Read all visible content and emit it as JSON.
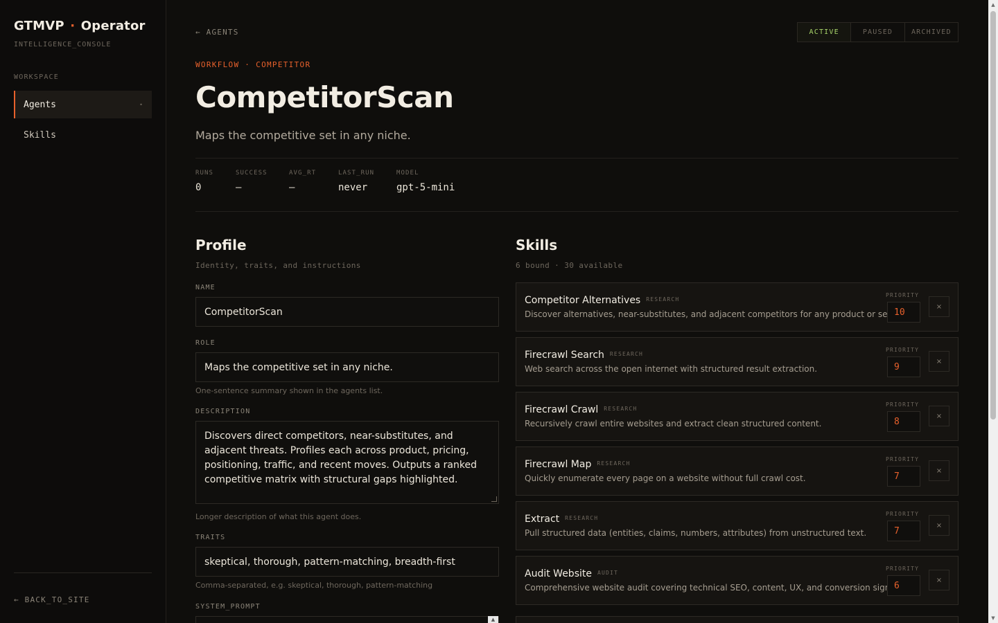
{
  "sidebar": {
    "brand_left": "GTMVP",
    "brand_sep": "·",
    "brand_right": "Operator",
    "brand_sub": "INTELLIGENCE_CONSOLE",
    "section_label": "WORKSPACE",
    "items": [
      {
        "label": "Agents",
        "active": true,
        "dot": "•"
      },
      {
        "label": "Skills",
        "active": false
      }
    ],
    "back_link": "← BACK_TO_SITE"
  },
  "header": {
    "back_link": "← AGENTS",
    "status_options": [
      "ACTIVE",
      "PAUSED",
      "ARCHIVED"
    ],
    "status_selected": "ACTIVE",
    "eyebrow": "WORKFLOW · COMPETITOR",
    "title": "CompetitorScan",
    "subtitle": "Maps the competitive set in any niche."
  },
  "stats": [
    {
      "key": "RUNS",
      "value": "0"
    },
    {
      "key": "SUCCESS",
      "value": "—"
    },
    {
      "key": "AVG_RT",
      "value": "—"
    },
    {
      "key": "LAST_RUN",
      "value": "never"
    },
    {
      "key": "MODEL",
      "value": "gpt-5-mini"
    }
  ],
  "profile": {
    "title": "Profile",
    "subtitle": "Identity, traits, and instructions",
    "name_label": "NAME",
    "name_value": "CompetitorScan",
    "role_label": "ROLE",
    "role_value": "Maps the competitive set in any niche.",
    "role_hint": "One-sentence summary shown in the agents list.",
    "description_label": "DESCRIPTION",
    "description_value": "Discovers direct competitors, near-substitutes, and adjacent threats. Profiles each across product, pricing, positioning, traffic, and recent moves. Outputs a ranked competitive matrix with structural gaps highlighted.",
    "description_hint": "Longer description of what this agent does.",
    "traits_label": "TRAITS",
    "traits_value": "skeptical, thorough, pattern-matching, breadth-first",
    "traits_hint": "Comma-separated, e.g. skeptical, thorough, pattern-matching",
    "system_prompt_label": "SYSTEM_PROMPT"
  },
  "skills": {
    "title": "Skills",
    "subtitle": "6 bound · 30 available",
    "priority_label": "PRIORITY",
    "remove_glyph": "×",
    "items": [
      {
        "name": "Competitor Alternatives",
        "tag": "RESEARCH",
        "desc": "Discover alternatives, near-substitutes, and adjacent competitors for any product or service.",
        "priority": "10"
      },
      {
        "name": "Firecrawl Search",
        "tag": "RESEARCH",
        "desc": "Web search across the open internet with structured result extraction.",
        "priority": "9"
      },
      {
        "name": "Firecrawl Crawl",
        "tag": "RESEARCH",
        "desc": "Recursively crawl entire websites and extract clean structured content.",
        "priority": "8"
      },
      {
        "name": "Firecrawl Map",
        "tag": "RESEARCH",
        "desc": "Quickly enumerate every page on a website without full crawl cost.",
        "priority": "7"
      },
      {
        "name": "Extract",
        "tag": "RESEARCH",
        "desc": "Pull structured data (entities, claims, numbers, attributes) from unstructured text.",
        "priority": "7"
      },
      {
        "name": "Audit Website",
        "tag": "AUDIT",
        "desc": "Comprehensive website audit covering technical SEO, content, UX, and conversion signals.",
        "priority": "6"
      }
    ]
  },
  "colors": {
    "accent": "#e8612c",
    "active_status": "#a9d66a",
    "background": "#0f0e0c"
  }
}
